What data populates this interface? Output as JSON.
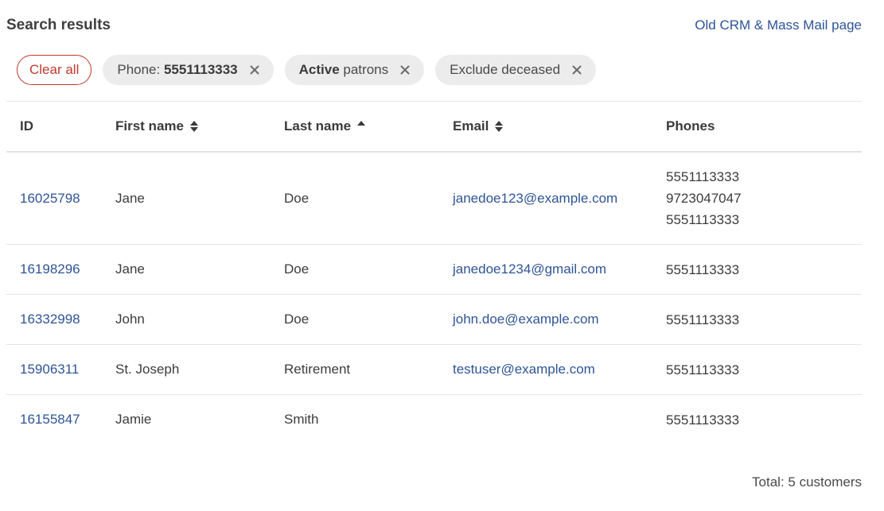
{
  "header": {
    "title": "Search results",
    "link": "Old CRM & Mass Mail page"
  },
  "filters": {
    "clear_all": "Clear all",
    "chips": [
      {
        "bold": "",
        "prefix": "Phone: ",
        "value": "5551113333"
      },
      {
        "bold": "Active",
        "rest": " patrons"
      },
      {
        "text": "Exclude deceased"
      }
    ]
  },
  "table": {
    "columns": {
      "id": "ID",
      "first_name": "First name",
      "last_name": "Last name",
      "email": "Email",
      "phones": "Phones"
    },
    "rows": [
      {
        "id": "16025798",
        "first": "Jane",
        "last": "Doe",
        "email": "janedoe123@example.com",
        "phones": [
          "5551113333",
          "9723047047",
          "5551113333"
        ]
      },
      {
        "id": "16198296",
        "first": "Jane",
        "last": "Doe",
        "email": "janedoe1234@gmail.com",
        "phones": [
          "5551113333"
        ]
      },
      {
        "id": "16332998",
        "first": "John",
        "last": "Doe",
        "email": "john.doe@example.com",
        "phones": [
          "5551113333"
        ]
      },
      {
        "id": "15906311",
        "first": "St. Joseph",
        "last": "Retirement",
        "email": "testuser@example.com",
        "phones": [
          "5551113333"
        ]
      },
      {
        "id": "16155847",
        "first": "Jamie",
        "last": "Smith",
        "email": "",
        "phones": [
          "5551113333"
        ]
      }
    ]
  },
  "footer": {
    "total": "Total: 5 customers"
  },
  "colors": {
    "link": "#2f5496",
    "danger": "#c0392b",
    "chip_bg": "#ececec"
  },
  "icons": {
    "chip_close": "close-icon",
    "sort_both": "sort-icon",
    "sort_asc": "sort-asc-icon"
  }
}
